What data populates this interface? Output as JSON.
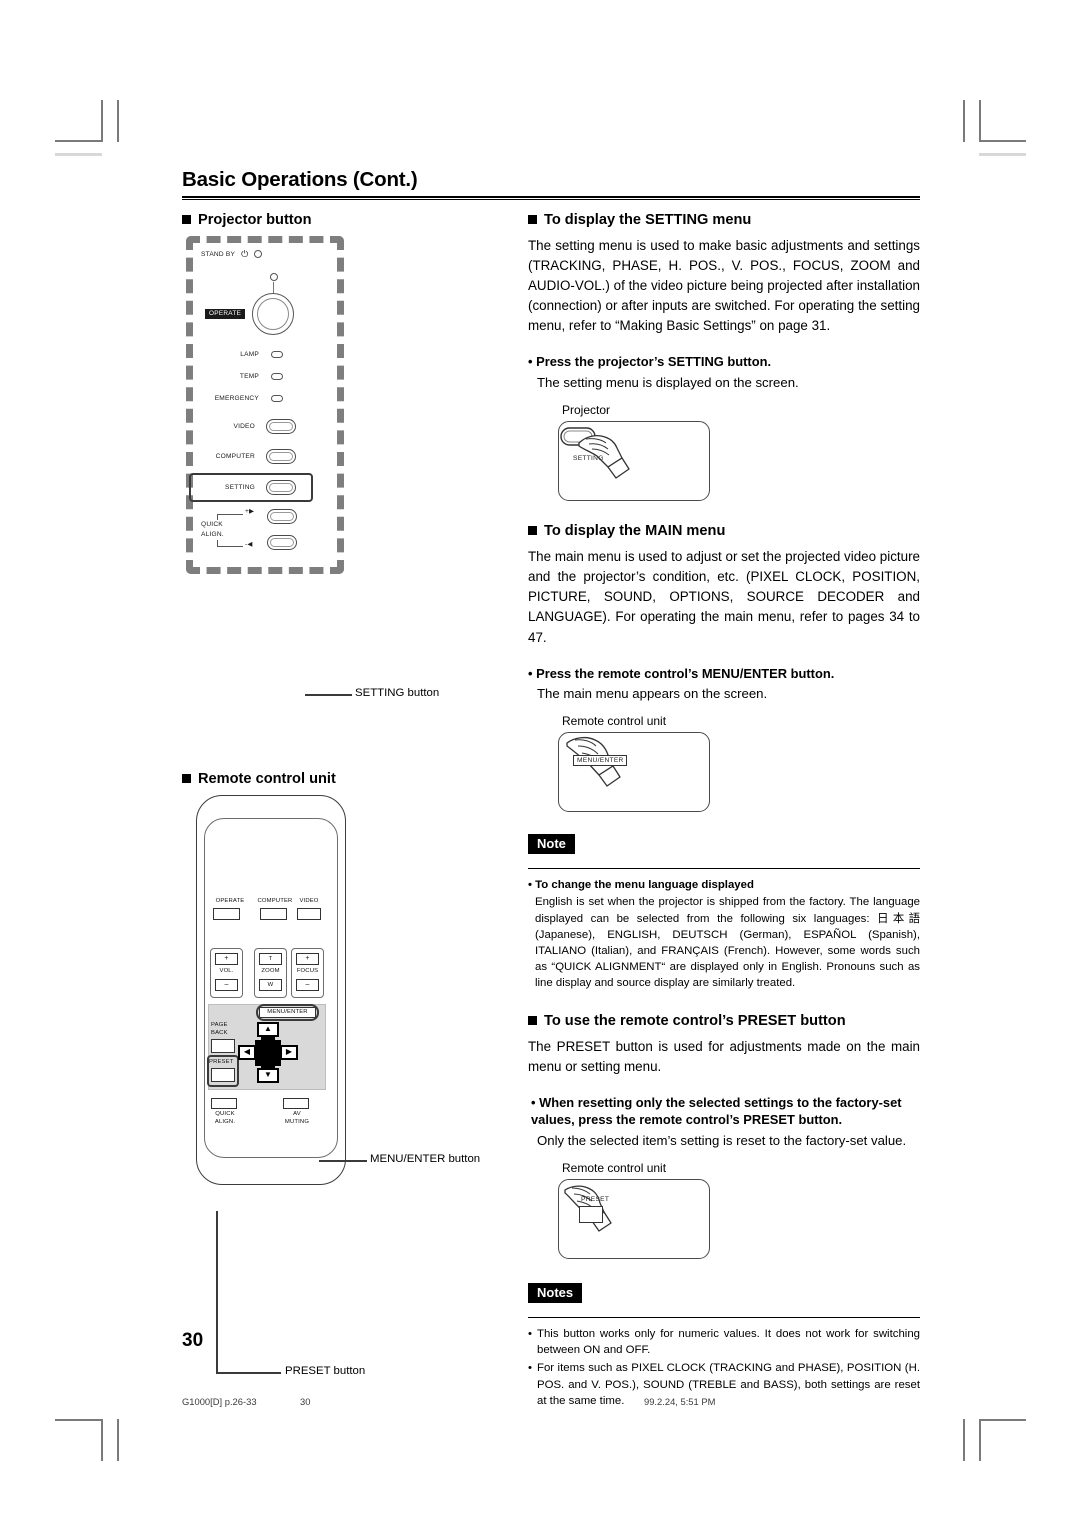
{
  "document": {
    "title": "Basic Operations (Cont.)",
    "page_number": "30",
    "footer_left": "G1000[D]  p.26-33",
    "footer_center": "30",
    "footer_right": "99.2.24, 5:51 PM"
  },
  "left_column": {
    "projector_section": {
      "heading": "Projector button",
      "panel": {
        "stand_by_label": "STAND BY",
        "power_glyph": "⏻",
        "operate_label": "OPERATE",
        "indicators": [
          "LAMP",
          "TEMP",
          "EMERGENCY"
        ],
        "buttons": [
          "VIDEO",
          "COMPUTER",
          "SETTING"
        ],
        "quick_label_line1": "QUICK",
        "quick_label_line2": "ALIGN.",
        "quick_plus": "+",
        "quick_minus": "-"
      },
      "callout": "SETTING button"
    },
    "remote_section": {
      "heading": "Remote control unit",
      "buttons": {
        "operate": "OPERATE",
        "computer": "COMPUTER",
        "video": "VIDEO",
        "vol": "VOL.",
        "vol_plus": "+",
        "vol_minus": "–",
        "zoom": "ZOOM",
        "zoom_t": "T",
        "zoom_w": "W",
        "focus": "FOCUS",
        "focus_plus": "+",
        "focus_minus": "–",
        "menu_enter": "MENU/ENTER",
        "page_back_line1": "PAGE",
        "page_back_line2": "BACK",
        "preset": "PRESET",
        "quick_align_line1": "QUICK",
        "quick_align_line2": "ALIGN.",
        "av_muting_line1": "AV",
        "av_muting_line2": "MUTING",
        "arrow_up": "▲",
        "arrow_down": "▼",
        "arrow_left": "◀",
        "arrow_right": "▶"
      },
      "callout_menu": "MENU/ENTER button",
      "callout_preset": "PRESET button"
    }
  },
  "right_column": {
    "setting_menu": {
      "heading": "To display the SETTING menu",
      "body": "The setting menu is used to make basic adjustments and settings (TRACKING, PHASE, H. POS., V. POS., FOCUS, ZOOM and AUDIO-VOL.) of the video picture being projected after installation (connection) or after inputs are switched. For operating the setting menu, refer to “Making Basic Settings” on page 31.",
      "step": "• Press the projector’s SETTING button.",
      "step_sub": "The setting menu is displayed on the screen.",
      "figure_caption": "Projector",
      "figure_button_label": "SETTING"
    },
    "main_menu": {
      "heading": "To display the MAIN menu",
      "body": "The main menu is used to adjust or set the projected video picture and the projector’s condition, etc. (PIXEL CLOCK, POSITION, PICTURE, SOUND, OPTIONS, SOURCE DECODER and LANGUAGE). For operating the main menu, refer to pages 34 to 47.",
      "step": "• Press the remote control’s MENU/ENTER button.",
      "step_sub": "The main menu appears on the screen.",
      "figure_caption": "Remote control unit",
      "figure_button_label": "MENU/ENTER"
    },
    "note": {
      "tag": "Note",
      "bullet_title": "• To change the menu language displayed",
      "body": "English is set when the projector is shipped from the factory. The language displayed can be selected from the following six languages: 日本語 (Japanese), ENGLISH, DEUTSCH (German), ESPAÑOL (Spanish), ITALIANO (Italian), and FRANÇAIS (French). However, some words such as “QUICK ALIGNMENT“ are displayed only in English. Pronouns such as line display and source display are similarly treated."
    },
    "preset_section": {
      "heading": "To use the remote control’s PRESET button",
      "body": "The PRESET button is used for adjustments made on the main menu or setting menu.",
      "step": "• When resetting only the selected settings to the factory-set values, press the remote control’s PRESET button.",
      "step_sub": "Only the selected item’s setting is reset to the factory-set value.",
      "figure_caption": "Remote control unit",
      "figure_button_label": "PRESET"
    },
    "notes": {
      "tag": "Notes",
      "items": [
        "This button works only for numeric values. It does not work for switching between ON and OFF.",
        "For items such as PIXEL CLOCK (TRACKING and PHASE), POSITION (H. POS. and V. POS.), SOUND (TREBLE and BASS), both settings are reset at the same time."
      ],
      "bullet": "•"
    }
  }
}
